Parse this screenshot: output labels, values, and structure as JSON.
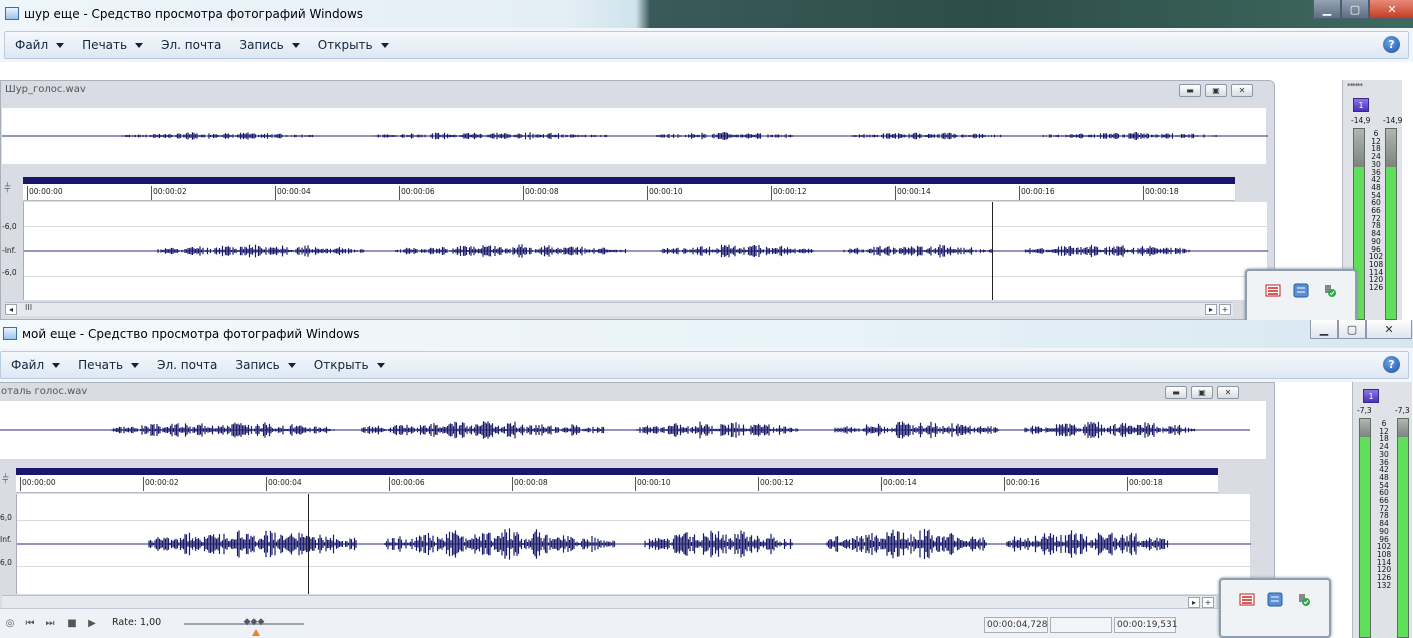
{
  "window1": {
    "title": "шур еще - Средство просмотра фотографий Windows",
    "caption": {
      "min": "▁",
      "max": "▢",
      "close": "✕"
    },
    "menu": [
      {
        "label": "Файл",
        "has_arrow": true
      },
      {
        "label": "Печать",
        "has_arrow": true
      },
      {
        "label": "Эл. почта",
        "has_arrow": false
      },
      {
        "label": "Запись",
        "has_arrow": true
      },
      {
        "label": "Открыть",
        "has_arrow": true
      }
    ],
    "help": "?",
    "wav": {
      "filename": "Шур_голос.wav",
      "time_ticks": [
        "00:00:00",
        "00:00:02",
        "00:00:04",
        "00:00:06",
        "00:00:08",
        "00:00:10",
        "00:00:12",
        "00:00:14",
        "00:00:16",
        "00:00:18"
      ],
      "db_labels": [
        "-6,0",
        "-Inf.",
        "-6,0"
      ],
      "scroll_label": "III"
    },
    "meter": {
      "header": "******",
      "channel": "1",
      "peak_left": "-14,9",
      "peak_right": "-14,9",
      "scale": [
        "6",
        "12",
        "18",
        "24",
        "30",
        "36",
        "42",
        "48",
        "54",
        "60",
        "66",
        "72",
        "78",
        "84",
        "90",
        "96",
        "102",
        "108",
        "114",
        "120",
        "126"
      ]
    }
  },
  "window2": {
    "title": "мой еще - Средство просмотра фотографий Windows",
    "caption": {
      "min": "▁",
      "max": "▢",
      "close": "✕"
    },
    "menu": [
      {
        "label": "Файл",
        "has_arrow": true
      },
      {
        "label": "Печать",
        "has_arrow": true
      },
      {
        "label": "Эл. почта",
        "has_arrow": false
      },
      {
        "label": "Запись",
        "has_arrow": true
      },
      {
        "label": "Открыть",
        "has_arrow": true
      }
    ],
    "help": "?",
    "wav": {
      "filename": "оталь голос.wav",
      "time_ticks": [
        "00:00:00",
        "00:00:02",
        "00:00:04",
        "00:00:06",
        "00:00:08",
        "00:00:10",
        "00:00:12",
        "00:00:14",
        "00:00:16",
        "00:00:18"
      ],
      "db_labels": [
        "6,0",
        "Inf.",
        "6,0"
      ]
    },
    "meter": {
      "channel": "1",
      "peak_left": "-7,3",
      "peak_right": "-7,3",
      "scale": [
        "6",
        "12",
        "18",
        "24",
        "30",
        "36",
        "42",
        "48",
        "54",
        "60",
        "66",
        "72",
        "78",
        "84",
        "90",
        "96",
        "102",
        "108",
        "114",
        "120",
        "126",
        "132"
      ]
    },
    "transport": {
      "rate_label": "Rate: 1,00",
      "position": "00:00:04,728",
      "length": "00:00:19,531",
      "empty_field": ""
    }
  },
  "colors": {
    "waveform": "#1a1a6a",
    "meter_green": "#60e05a",
    "ruler_bar": "#18176c"
  }
}
